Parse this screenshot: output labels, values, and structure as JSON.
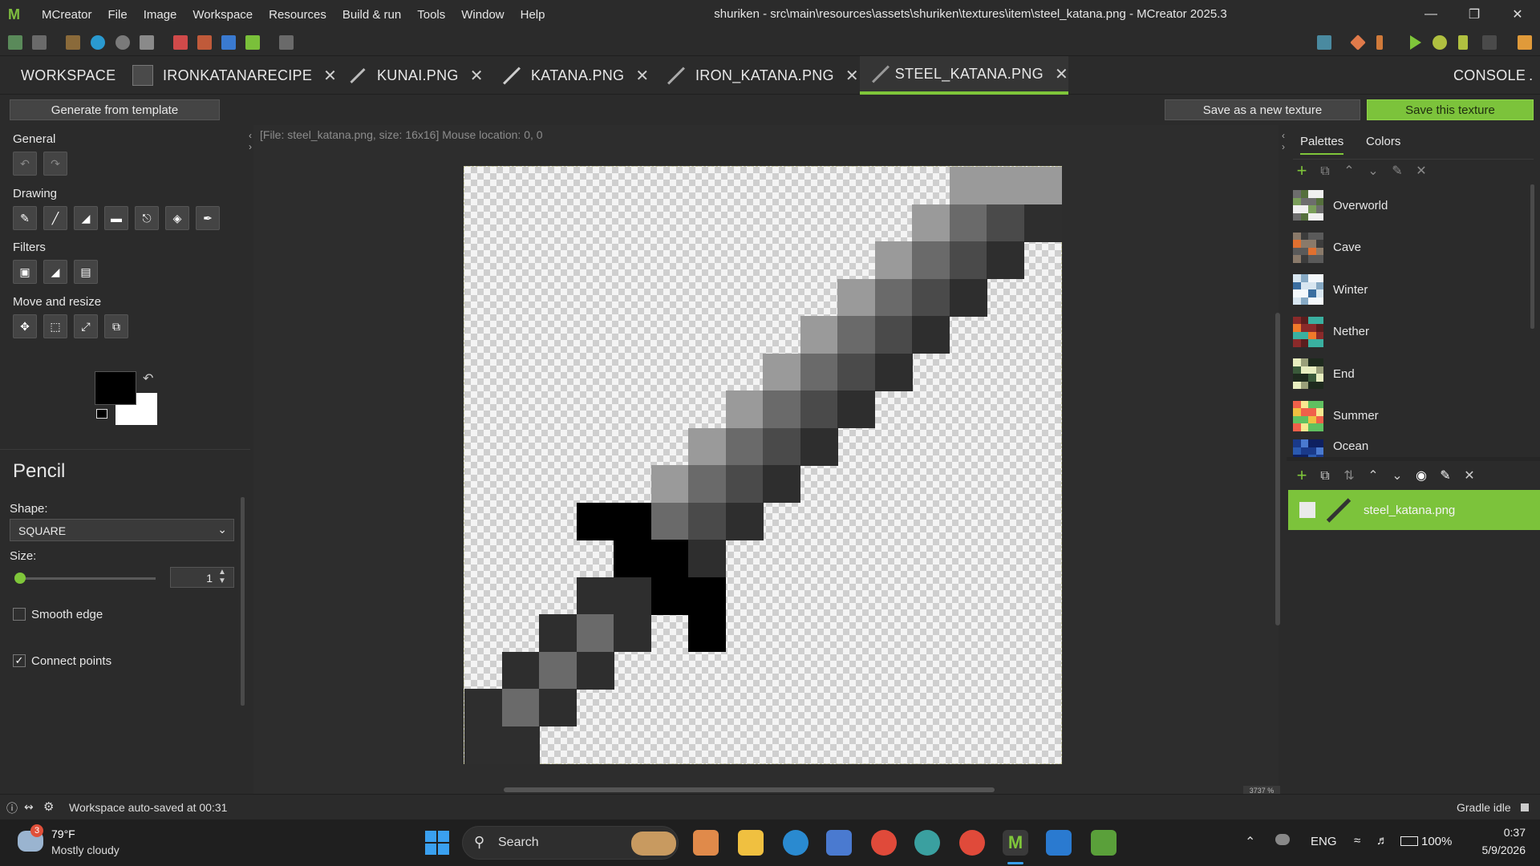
{
  "menu": {
    "app_name": "MCreator",
    "items": [
      "File",
      "Image",
      "Workspace",
      "Resources",
      "Build & run",
      "Tools",
      "Window",
      "Help"
    ],
    "window_title": "shuriken - src\\main\\resources\\assets\\shuriken\\textures\\item\\steel_katana.png - MCreator 2025.3"
  },
  "tabs": {
    "workspace": "WORKSPACE",
    "items": [
      "IRONKATANARECIPE",
      "KUNAI.PNG",
      "KATANA.PNG",
      "IRON_KATANA.PNG",
      "STEEL_KATANA.PNG"
    ],
    "active": "STEEL_KATANA.PNG",
    "console": "CONSOLE"
  },
  "subbar": {
    "generate": "Generate from template",
    "save_new": "Save as a new texture",
    "save": "Save this texture"
  },
  "left": {
    "general": "General",
    "drawing": "Drawing",
    "filters": "Filters",
    "move_resize": "Move and resize",
    "tool_name": "Pencil",
    "shape_label": "Shape:",
    "shape_value": "SQUARE",
    "size_label": "Size:",
    "size_value": "1",
    "smooth_edge": "Smooth edge",
    "smooth_checked": false,
    "connect_points": "Connect points",
    "connect_checked": true,
    "primary_color": "#000000",
    "secondary_color": "#ffffff"
  },
  "canvas": {
    "info": "[File: steel_katana.png, size: 16x16] Mouse location: 0, 0",
    "zoom": "3737 %",
    "pixels": [
      [
        13,
        0,
        "#9a9a9a"
      ],
      [
        14,
        0,
        "#9a9a9a"
      ],
      [
        15,
        0,
        "#9a9a9a"
      ],
      [
        12,
        1,
        "#9a9a9a"
      ],
      [
        13,
        1,
        "#6a6a6a"
      ],
      [
        14,
        1,
        "#4a4a4a"
      ],
      [
        15,
        1,
        "#2e2e2e"
      ],
      [
        11,
        2,
        "#9a9a9a"
      ],
      [
        12,
        2,
        "#6a6a6a"
      ],
      [
        13,
        2,
        "#4a4a4a"
      ],
      [
        14,
        2,
        "#2e2e2e"
      ],
      [
        10,
        3,
        "#9a9a9a"
      ],
      [
        11,
        3,
        "#6a6a6a"
      ],
      [
        12,
        3,
        "#4a4a4a"
      ],
      [
        13,
        3,
        "#2e2e2e"
      ],
      [
        9,
        4,
        "#9a9a9a"
      ],
      [
        10,
        4,
        "#6a6a6a"
      ],
      [
        11,
        4,
        "#4a4a4a"
      ],
      [
        12,
        4,
        "#2e2e2e"
      ],
      [
        8,
        5,
        "#9a9a9a"
      ],
      [
        9,
        5,
        "#6a6a6a"
      ],
      [
        10,
        5,
        "#4a4a4a"
      ],
      [
        11,
        5,
        "#2e2e2e"
      ],
      [
        7,
        6,
        "#9a9a9a"
      ],
      [
        8,
        6,
        "#6a6a6a"
      ],
      [
        9,
        6,
        "#4a4a4a"
      ],
      [
        10,
        6,
        "#2e2e2e"
      ],
      [
        6,
        7,
        "#9a9a9a"
      ],
      [
        7,
        7,
        "#6a6a6a"
      ],
      [
        8,
        7,
        "#4a4a4a"
      ],
      [
        9,
        7,
        "#2e2e2e"
      ],
      [
        5,
        8,
        "#9a9a9a"
      ],
      [
        6,
        8,
        "#6a6a6a"
      ],
      [
        7,
        8,
        "#4a4a4a"
      ],
      [
        8,
        8,
        "#2e2e2e"
      ],
      [
        3,
        9,
        "#000000"
      ],
      [
        4,
        9,
        "#000000"
      ],
      [
        5,
        9,
        "#6a6a6a"
      ],
      [
        6,
        9,
        "#4a4a4a"
      ],
      [
        7,
        9,
        "#2e2e2e"
      ],
      [
        4,
        10,
        "#000000"
      ],
      [
        5,
        10,
        "#000000"
      ],
      [
        6,
        10,
        "#2e2e2e"
      ],
      [
        3,
        11,
        "#2e2e2e"
      ],
      [
        4,
        11,
        "#2e2e2e"
      ],
      [
        5,
        11,
        "#000000"
      ],
      [
        6,
        11,
        "#000000"
      ],
      [
        2,
        12,
        "#2e2e2e"
      ],
      [
        3,
        12,
        "#6a6a6a"
      ],
      [
        4,
        12,
        "#2e2e2e"
      ],
      [
        6,
        12,
        "#000000"
      ],
      [
        1,
        13,
        "#2e2e2e"
      ],
      [
        2,
        13,
        "#6a6a6a"
      ],
      [
        3,
        13,
        "#2e2e2e"
      ],
      [
        0,
        14,
        "#2e2e2e"
      ],
      [
        1,
        14,
        "#6a6a6a"
      ],
      [
        2,
        14,
        "#2e2e2e"
      ],
      [
        0,
        15,
        "#2e2e2e"
      ],
      [
        1,
        15,
        "#2e2e2e"
      ]
    ]
  },
  "right": {
    "tab_palettes": "Palettes",
    "tab_colors": "Colors",
    "palettes": [
      {
        "name": "Overworld",
        "colors": [
          "#6d6d6d",
          "#7a9e5a",
          "#f0f0f0",
          "#55703c"
        ]
      },
      {
        "name": "Cave",
        "colors": [
          "#8a7a6a",
          "#e07030",
          "#5a5a5a",
          "#3c3c3c"
        ]
      },
      {
        "name": "Winter",
        "colors": [
          "#d8e6f0",
          "#3a6ea0",
          "#f4f8fb",
          "#86a9c4"
        ]
      },
      {
        "name": "Nether",
        "colors": [
          "#8a2a2a",
          "#f07a2a",
          "#3ab0a0",
          "#5a1e1e"
        ]
      },
      {
        "name": "End",
        "colors": [
          "#e8eec0",
          "#3a5a3a",
          "#1e2a1e",
          "#9aa07a"
        ]
      },
      {
        "name": "Summer",
        "colors": [
          "#f0604a",
          "#f0c040",
          "#60c060",
          "#f8e890"
        ]
      },
      {
        "name": "Ocean",
        "colors": [
          "#1a3a8a",
          "#2a5ab0",
          "#0e2060",
          "#4a7ad0"
        ]
      }
    ],
    "layer_name": "steel_katana.png"
  },
  "status": {
    "text": "Workspace auto-saved at 00:31",
    "gradle": "Gradle idle"
  },
  "taskbar": {
    "weather_temp": "79°F",
    "weather_desc": "Mostly cloudy",
    "weather_badge": "3",
    "search": "Search",
    "lang": "ENG",
    "battery": "100%",
    "time": "0:37",
    "date": "5/9/2026"
  }
}
